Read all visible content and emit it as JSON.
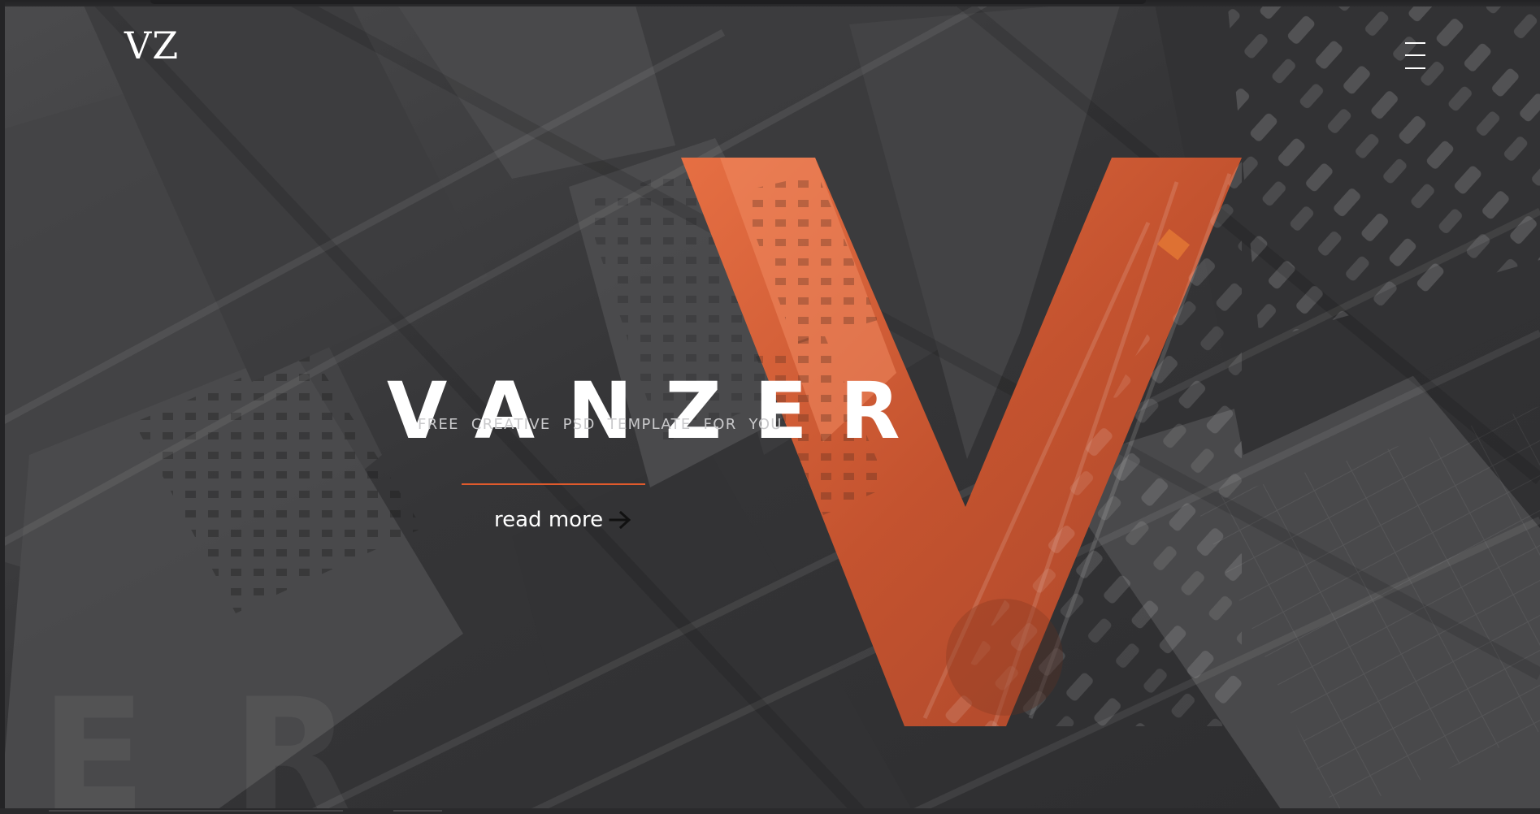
{
  "brand": {
    "logo": "VZ",
    "title": "VANZER",
    "subtitle": "FREE CREATIVE PSD TEMPLATE FOR YOU",
    "watermark": "ER",
    "hero_letter": "V"
  },
  "actions": {
    "read_more": "read more",
    "menu_icon": "hamburger-menu-icon",
    "arrow_icon": "arrow-right-icon"
  },
  "colors": {
    "accent": "#e05a2c",
    "background": "#343436",
    "text": "#ffffff",
    "subtitle": "#c9c9cb"
  }
}
